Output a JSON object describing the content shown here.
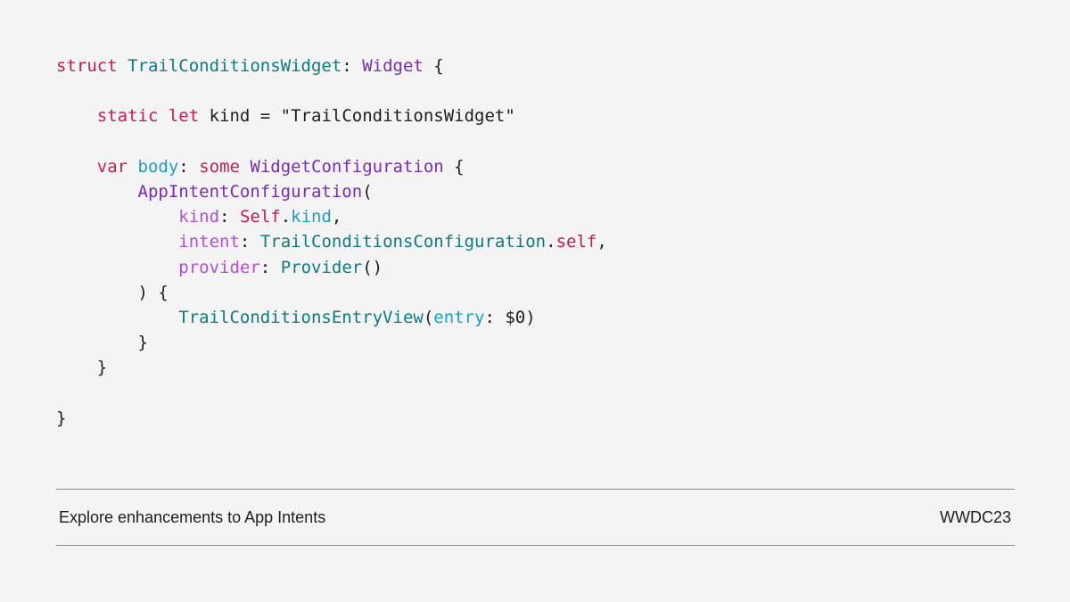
{
  "colors": {
    "background": "#f4f4f4",
    "keyword": "#c8195a",
    "type_name": "#0e7a80",
    "system_type": "#7b2bb0",
    "parameter": "#b14fd6",
    "property": "#1b9fc4",
    "plain": "#1d1d1f",
    "rule": "#8e8e8e"
  },
  "code_lines": [
    [
      {
        "text": "struct ",
        "color": "#c8195a"
      },
      {
        "text": "TrailConditionsWidget",
        "color": "#0e7a80"
      },
      {
        "text": ": ",
        "color": "#1d1d1f"
      },
      {
        "text": "Widget",
        "color": "#7b2bb0"
      },
      {
        "text": " {",
        "color": "#1d1d1f"
      }
    ],
    [],
    [
      {
        "text": "    ",
        "color": "#1d1d1f"
      },
      {
        "text": "static let ",
        "color": "#c8195a"
      },
      {
        "text": "kind = \"TrailConditionsWidget\"",
        "color": "#1d1d1f"
      }
    ],
    [],
    [
      {
        "text": "    ",
        "color": "#1d1d1f"
      },
      {
        "text": "var ",
        "color": "#c8195a"
      },
      {
        "text": "body",
        "color": "#1b9fc4"
      },
      {
        "text": ": ",
        "color": "#1d1d1f"
      },
      {
        "text": "some ",
        "color": "#c8195a"
      },
      {
        "text": "WidgetConfiguration",
        "color": "#7b2bb0"
      },
      {
        "text": " {",
        "color": "#1d1d1f"
      }
    ],
    [
      {
        "text": "        ",
        "color": "#1d1d1f"
      },
      {
        "text": "AppIntentConfiguration",
        "color": "#7b2bb0"
      },
      {
        "text": "(",
        "color": "#1d1d1f"
      }
    ],
    [
      {
        "text": "            ",
        "color": "#1d1d1f"
      },
      {
        "text": "kind",
        "color": "#b14fd6"
      },
      {
        "text": ": ",
        "color": "#1d1d1f"
      },
      {
        "text": "Self",
        "color": "#c8195a"
      },
      {
        "text": ".",
        "color": "#1d1d1f"
      },
      {
        "text": "kind",
        "color": "#1b9fc4"
      },
      {
        "text": ",",
        "color": "#1d1d1f"
      }
    ],
    [
      {
        "text": "            ",
        "color": "#1d1d1f"
      },
      {
        "text": "intent",
        "color": "#b14fd6"
      },
      {
        "text": ": ",
        "color": "#1d1d1f"
      },
      {
        "text": "TrailConditionsConfiguration",
        "color": "#0e7a80"
      },
      {
        "text": ".",
        "color": "#1d1d1f"
      },
      {
        "text": "self",
        "color": "#c8195a"
      },
      {
        "text": ",",
        "color": "#1d1d1f"
      }
    ],
    [
      {
        "text": "            ",
        "color": "#1d1d1f"
      },
      {
        "text": "provider",
        "color": "#b14fd6"
      },
      {
        "text": ": ",
        "color": "#1d1d1f"
      },
      {
        "text": "Provider",
        "color": "#0e7a80"
      },
      {
        "text": "()",
        "color": "#1d1d1f"
      }
    ],
    [
      {
        "text": "        ) {",
        "color": "#1d1d1f"
      }
    ],
    [
      {
        "text": "            ",
        "color": "#1d1d1f"
      },
      {
        "text": "TrailConditionsEntryView",
        "color": "#0e7a80"
      },
      {
        "text": "(",
        "color": "#1d1d1f"
      },
      {
        "text": "entry",
        "color": "#1b9fc4"
      },
      {
        "text": ": $0)",
        "color": "#1d1d1f"
      }
    ],
    [
      {
        "text": "        }",
        "color": "#1d1d1f"
      }
    ],
    [
      {
        "text": "    }",
        "color": "#1d1d1f"
      }
    ],
    [],
    [
      {
        "text": "}",
        "color": "#1d1d1f"
      }
    ]
  ],
  "footer": {
    "session_title": "Explore enhancements to App Intents",
    "event": "WWDC23"
  }
}
